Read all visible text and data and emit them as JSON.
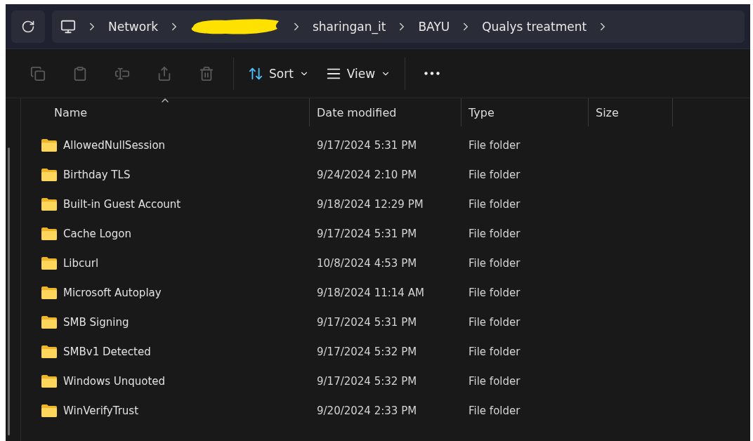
{
  "address_bar": {
    "breadcrumbs": [
      {
        "kind": "computer"
      },
      {
        "kind": "folder",
        "label": "Network"
      },
      {
        "kind": "redacted"
      },
      {
        "kind": "folder",
        "label": "sharingan_it"
      },
      {
        "kind": "folder",
        "label": "BAYU"
      },
      {
        "kind": "folder",
        "label": "Qualys treatment"
      }
    ]
  },
  "toolbar": {
    "actions": [
      {
        "kind": "copy",
        "disabled": true
      },
      {
        "kind": "paste",
        "disabled": true
      },
      {
        "kind": "rename",
        "disabled": true
      },
      {
        "kind": "share",
        "disabled": true
      },
      {
        "kind": "delete",
        "disabled": true
      }
    ],
    "sort": {
      "label": "Sort"
    },
    "view": {
      "label": "View"
    }
  },
  "table": {
    "columns": [
      {
        "label": "Name",
        "sorted": true
      },
      {
        "label": "Date modified",
        "sorted": false
      },
      {
        "label": "Type",
        "sorted": false
      },
      {
        "label": "Size",
        "sorted": false
      }
    ],
    "rows": [
      {
        "name": "AllowedNullSession",
        "date": "9/17/2024 5:31 PM",
        "type": "File folder"
      },
      {
        "name": "Birthday TLS",
        "date": "9/24/2024 2:10 PM",
        "type": "File folder"
      },
      {
        "name": "Built-in Guest Account",
        "date": "9/18/2024 12:29 PM",
        "type": "File folder"
      },
      {
        "name": "Cache Logon",
        "date": "9/17/2024 5:31 PM",
        "type": "File folder"
      },
      {
        "name": "Libcurl",
        "date": "10/8/2024 4:53 PM",
        "type": "File folder"
      },
      {
        "name": "Microsoft Autoplay",
        "date": "9/18/2024 11:14 AM",
        "type": "File folder"
      },
      {
        "name": "SMB Signing",
        "date": "9/17/2024 5:31 PM",
        "type": "File folder"
      },
      {
        "name": "SMBv1 Detected",
        "date": "9/17/2024 5:32 PM",
        "type": "File folder"
      },
      {
        "name": "Windows Unquoted",
        "date": "9/17/2024 5:32 PM",
        "type": "File folder"
      },
      {
        "name": "WinVerifyTrust",
        "date": "9/20/2024 2:33 PM",
        "type": "File folder"
      }
    ]
  }
}
